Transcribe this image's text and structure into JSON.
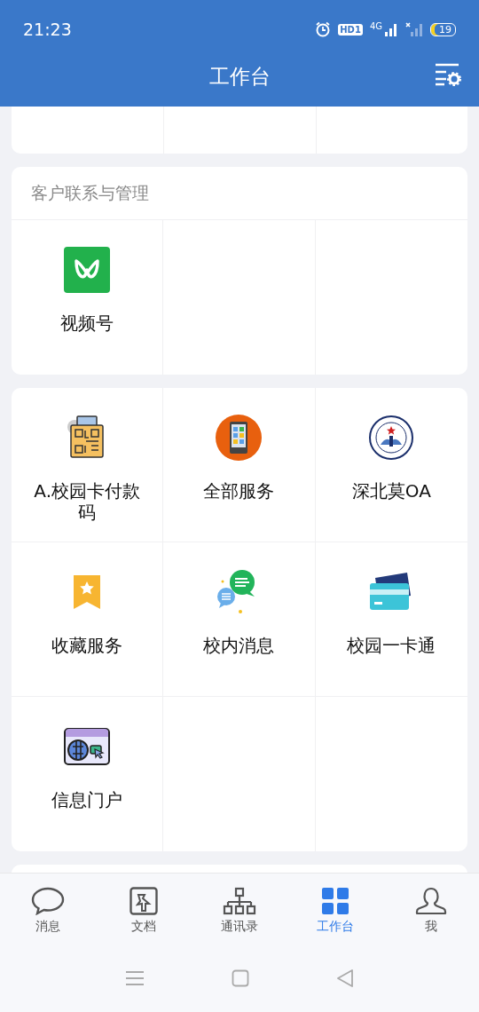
{
  "status_bar": {
    "time": "21:23",
    "hd": "HD1",
    "network": "4G",
    "battery": "19"
  },
  "header": {
    "title": "工作台"
  },
  "sections": [
    {
      "title": "客户联系与管理",
      "apps": [
        {
          "label": "视频号",
          "kind": "loop"
        }
      ]
    },
    {
      "apps": [
        {
          "label": "A.校园卡付款码",
          "kind": "qr"
        },
        {
          "label": "全部服务",
          "kind": "phone"
        },
        {
          "label": "深北莫OA",
          "kind": "emblem"
        },
        {
          "label": "收藏服务",
          "kind": "bookmark"
        },
        {
          "label": "校内消息",
          "kind": "chat"
        },
        {
          "label": "校园一卡通",
          "kind": "cards"
        },
        {
          "label": "信息门户",
          "kind": "browser"
        }
      ]
    }
  ],
  "tabs": [
    {
      "label": "消息",
      "kind": "chat",
      "selected": false
    },
    {
      "label": "文档",
      "kind": "doc",
      "selected": false
    },
    {
      "label": "通讯录",
      "kind": "org",
      "selected": false
    },
    {
      "label": "工作台",
      "kind": "grid",
      "selected": true
    },
    {
      "label": "我",
      "kind": "person",
      "selected": false
    }
  ]
}
